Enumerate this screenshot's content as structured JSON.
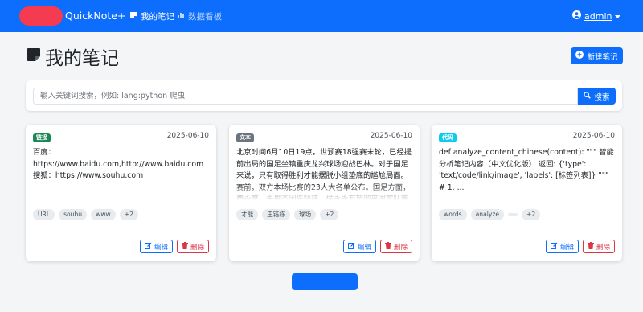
{
  "navbar": {
    "brand": "QuickNote+",
    "links": [
      {
        "label": "我的笔记",
        "icon": "note-icon",
        "active": true
      },
      {
        "label": "数据看板",
        "icon": "chart-icon",
        "active": false
      }
    ],
    "user": "admin"
  },
  "page": {
    "title": "我的笔记",
    "new_button": "新建笔记"
  },
  "search": {
    "placeholder": "输入关键词搜索，例如: lang:python 爬虫",
    "value": "",
    "button": "搜索"
  },
  "cards": [
    {
      "type": "链接",
      "type_color": "#198754",
      "date": "2025-06-10",
      "content": "百度：https://www.baidu.com,http://www.baidu.com 搜狐：https://www.souhu.com",
      "tags": [
        "URL",
        "souhu",
        "www",
        "+2"
      ],
      "edit": "编辑",
      "delete": "删除"
    },
    {
      "type": "文本",
      "type_color": "#6c757d",
      "date": "2025-06-10",
      "content": "北京时间6月10日19点，世预赛18强赛末轮，已经提前出局的国足坐镇重庆龙兴球场迎战巴林。对于国足来说，只有取得胜利才能摆脱小组垫底的尴尬局面。赛前，双方本场比赛的23人大名单公布。国足方面，费永亮、朱思杰因伤缺阵，侯永永有望迎来国家队首",
      "tags": [
        "才能",
        "王钰栋",
        "球场",
        "+2"
      ],
      "edit": "编辑",
      "delete": "删除"
    },
    {
      "type": "代码",
      "type_color": "#0dcaf0",
      "date": "2025-06-10",
      "content": "def analyze_content_chinese(content): \"\"\" 智能分析笔记内容（中文优化版） 返回: {'type': 'text/code/link/image', 'labels': [标签列表]} \"\"\" # 1. ...",
      "tags": [
        "words",
        "analyze",
        "",
        "+2"
      ],
      "edit": "编辑",
      "delete": "删除"
    }
  ],
  "colors": {
    "primary": "#0d6efd",
    "danger": "#dc3545",
    "brand_blob": "#f43b4f"
  }
}
